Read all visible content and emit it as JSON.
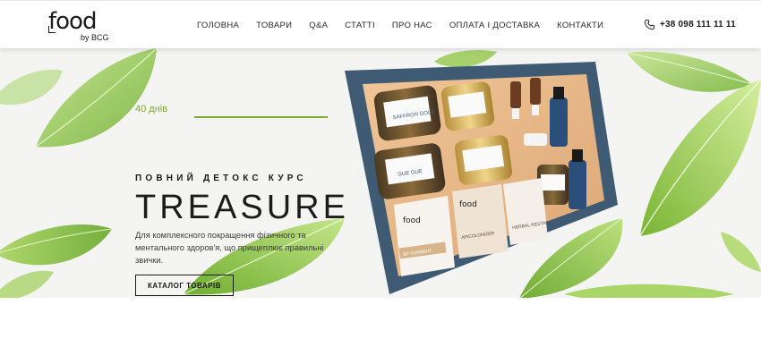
{
  "brand": {
    "logo_word": "food",
    "logo_sub": "by BCG"
  },
  "nav": {
    "items": [
      {
        "label": "ГОЛОВНА"
      },
      {
        "label": "ТОВАРИ"
      },
      {
        "label": "Q&A"
      },
      {
        "label": "СТАТТІ"
      },
      {
        "label": "ПРО НАС"
      },
      {
        "label": "ОПЛАТА І ДОСТАВКА"
      },
      {
        "label": "КОНТАКТИ"
      }
    ]
  },
  "contact": {
    "phone": "+38 098 111 11 11",
    "icon": "phone-icon"
  },
  "hero": {
    "days": "40 днів",
    "course": "ПОВНИЙ ДЕТОКС КУРС",
    "title": "TREASURE",
    "description": "Для комплексного покращення фізичного та ментального здоров'я, що прищеплює правильні звички.",
    "button": "КАТАЛОГ ТОВАРІВ"
  },
  "product_labels": {
    "jar1": "SAFFRON GOLD",
    "jar3": "GUE GUE",
    "bag1": "BP SORBENT",
    "bag2": "APICOLONIZER",
    "bag3": "HERBAL RESTART",
    "bag_brand": "food"
  },
  "colors": {
    "accent_green": "#7aab2a",
    "text_dark": "#1b1b1b",
    "box_blue": "#3f5b73",
    "box_kraft": "#e9b98a"
  }
}
